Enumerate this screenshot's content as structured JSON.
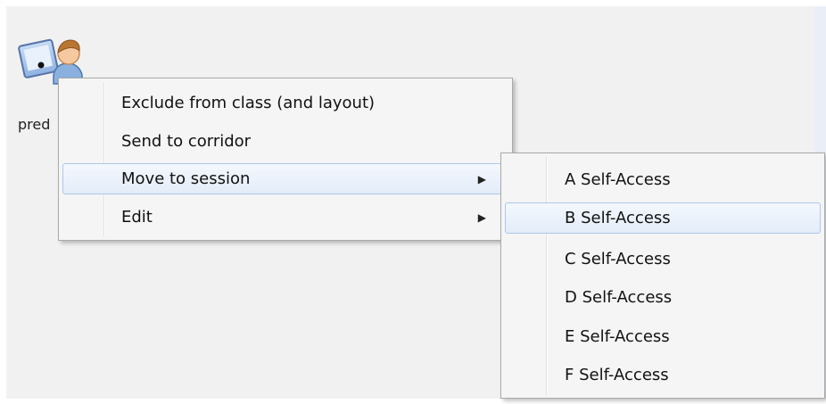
{
  "student": {
    "label": "pred",
    "icon": "student-computer-icon"
  },
  "context_menu": {
    "items": [
      {
        "label": "Exclude from class (and layout)"
      },
      {
        "label": "Send to corridor"
      },
      {
        "label": "Move to session",
        "arrow": "▶",
        "active": true
      },
      {
        "label": "Edit",
        "arrow": "▶"
      }
    ]
  },
  "session_submenu": {
    "items": [
      {
        "label": "A  Self-Access"
      },
      {
        "label": "B  Self-Access",
        "active": true
      },
      {
        "label": "C  Self-Access"
      },
      {
        "label": "D  Self-Access"
      },
      {
        "label": "E  Self-Access"
      },
      {
        "label": "F  Self-Access"
      }
    ]
  },
  "colors": {
    "highlight_border": "#adc7ea",
    "menu_bg": "#f5f5f5",
    "canvas_bg": "#f1f1f1"
  }
}
